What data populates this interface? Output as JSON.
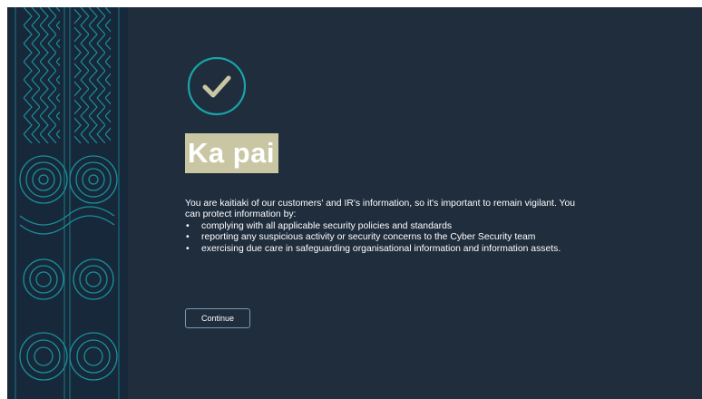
{
  "colors": {
    "background": "#1f2d3d",
    "accent_teal": "#1aa3a8",
    "check_color": "#c9c7a3",
    "heading_highlight": "#c9c7a3",
    "pattern_line": "#1b8f99"
  },
  "icons": {
    "success": "check-circle-icon",
    "side_panel": "kowhaiwhai-pattern"
  },
  "main": {
    "heading": "Ka pai",
    "intro": "You are kaitiaki of our customers' and IR's information, so it's important to remain vigilant. You can protect information by:",
    "bullets": [
      "complying with all applicable security policies and standards",
      "reporting any suspicious activity or security concerns to the Cyber Security team",
      "exercising due care in safeguarding organisational information and information assets."
    ],
    "continue_label": "Continue"
  }
}
